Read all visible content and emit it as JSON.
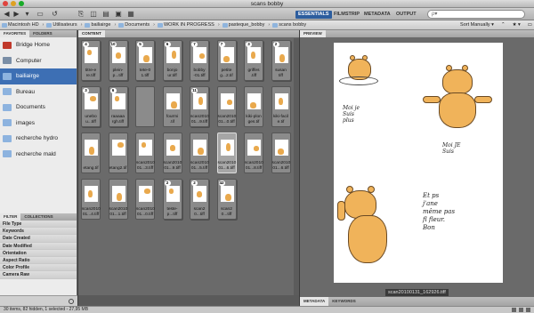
{
  "window": {
    "title": "scans bobby"
  },
  "toolbar": {
    "workspaces": [
      "ESSENTIALS",
      "FILMSTRIP",
      "METADATA",
      "OUTPUT"
    ],
    "active_workspace": "ESSENTIALS",
    "search_value": "ρ▾"
  },
  "path": {
    "crumbs": [
      "Macintosh HD",
      "Utilisateurs",
      "bailiairge",
      "Documents",
      "WORK IN PROGRESS",
      "pasteque_bobby",
      "scans bobby"
    ],
    "sort_label": "Sort Manually ▾"
  },
  "left_panel": {
    "tabs": [
      "FAVORITES",
      "FOLDERS"
    ],
    "favorites": [
      {
        "label": "Bridge Home",
        "icon": "bridge-home-icon",
        "color": "#c0392b"
      },
      {
        "label": "Computer",
        "icon": "computer-icon",
        "color": "#7a8ea6"
      },
      {
        "label": "bailiairge",
        "icon": "home-icon",
        "color": "#8db3df"
      },
      {
        "label": "Bureau",
        "icon": "folder-icon",
        "color": "#8db3df"
      },
      {
        "label": "Documents",
        "icon": "folder-icon",
        "color": "#8db3df"
      },
      {
        "label": "images",
        "icon": "folder-icon",
        "color": "#8db3df"
      },
      {
        "label": "recherche hydro",
        "icon": "folder-icon",
        "color": "#8db3df"
      },
      {
        "label": "recherche mald",
        "icon": "folder-icon",
        "color": "#8db3df"
      }
    ],
    "filter_tabs": [
      "FILTER",
      "COLLECTIONS"
    ],
    "filters": [
      "File Type",
      "Keywords",
      "Date Created",
      "Date Modified",
      "Orientation",
      "Aspect Ratio",
      "Color Profile",
      "Camera Raw"
    ]
  },
  "content": {
    "tab": "CONTENT",
    "thumbs": [
      {
        "badge": "4",
        "label": "titre-e\nre.tiff",
        "stack": true
      },
      {
        "badge": "10",
        "label": "plein-\np...tiff",
        "stack": true
      },
      {
        "badge": "5",
        "label": "tete-0\n1.tiff",
        "stack": true
      },
      {
        "badge": "6",
        "label": "bonjo\nur.tiff",
        "stack": true
      },
      {
        "badge": "7",
        "label": "bobby\n-01.tiff",
        "stack": true
      },
      {
        "badge": "7",
        "label": "petite\ng...2.tif",
        "stack": true
      },
      {
        "badge": "3",
        "label": "griffes\n.tiff",
        "stack": true
      },
      {
        "badge": "2",
        "label": "susan\ntiff",
        "stack": true
      },
      {
        "badge": "3",
        "label": "unebo\nu...tiff",
        "stack": true
      },
      {
        "badge": "6",
        "label": "raaaaa\nrgh.tiff",
        "stack": true
      },
      {
        "badge": "",
        "label": "",
        "stack": false
      },
      {
        "badge": "",
        "label": "fourmi\n.tif",
        "stack": false
      },
      {
        "badge": "11",
        "label": "scan2010\n01...9.tiff",
        "stack": true
      },
      {
        "badge": "",
        "label": "scan2010\n01...0.tiff",
        "stack": false
      },
      {
        "badge": "",
        "label": "kiki-plon\nges.tif",
        "stack": false
      },
      {
        "badge": "",
        "label": "kiki-facil\ne.tif",
        "stack": false
      },
      {
        "badge": "",
        "label": "etang.tif",
        "stack": false
      },
      {
        "badge": "",
        "label": "etang2.tif",
        "stack": false
      },
      {
        "badge": "",
        "label": "scan2010\n01...3.tiff",
        "stack": false
      },
      {
        "badge": "",
        "label": "scan2010\n01...9.tiff",
        "stack": false
      },
      {
        "badge": "",
        "label": "scan2010\n01...5.tiff",
        "stack": false
      },
      {
        "badge": "",
        "label": "scan2010\n01...6.tiff",
        "stack": false
      },
      {
        "badge": "",
        "label": "scan2010\n01...8.tiff",
        "stack": false
      },
      {
        "badge": "",
        "label": "scan2010\n01...6.tiff",
        "stack": false
      },
      {
        "badge": "",
        "label": "scan2010\n01...4.tiff",
        "stack": false
      },
      {
        "badge": "",
        "label": "scan2010\n01...1.tiff",
        "stack": false
      },
      {
        "badge": "",
        "label": "scan2010\n01...0.tiff",
        "stack": false
      },
      {
        "badge": "2",
        "label": "teste-\np...tiff",
        "stack": true
      },
      {
        "badge": "2",
        "label": "scan2\n0...tiff",
        "stack": true
      },
      {
        "badge": "42",
        "label": "scan2\n0...tiff",
        "stack": true
      }
    ],
    "selected_index": 21
  },
  "preview": {
    "tab": "PREVIEW",
    "caption": "scan20100131_162926.tiff",
    "texts": [
      "Moi je\nSuis\nplus",
      "Moi JE\nSuis",
      "Et ps\nj'ane\nmême pas\nfl fleur.\nBon"
    ],
    "bottom_tabs": [
      "METADATA",
      "KEYWORDS"
    ]
  },
  "status": {
    "text": "30 items, 82 hidden, 1 selected - 27,95 MB"
  }
}
